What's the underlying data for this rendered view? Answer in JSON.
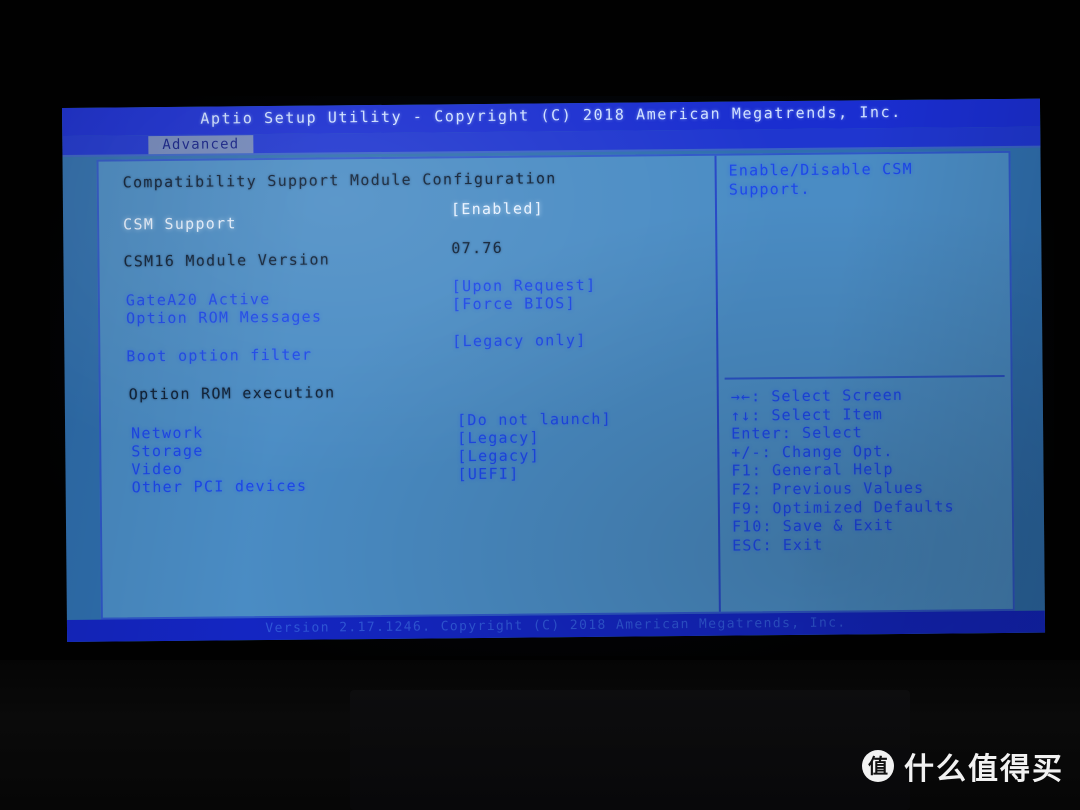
{
  "bios": {
    "title": "Aptio Setup Utility - Copyright (C) 2018 American Megatrends, Inc.",
    "version_bar": "Version 2.17.1246. Copyright (C) 2018 American Megatrends, Inc.",
    "tabs": [
      {
        "label": "Advanced",
        "selected": true
      }
    ],
    "page_heading": "Compatibility Support Module Configuration",
    "rows": [
      {
        "label": "CSM Support",
        "value": "[Enabled]",
        "kind": "selected"
      },
      {
        "label": "CSM16 Module Version",
        "value": "07.76",
        "kind": "static"
      },
      {
        "label": "GateA20 Active",
        "value": "[Upon Request]",
        "kind": "item"
      },
      {
        "label": "Option ROM Messages",
        "value": "[Force BIOS]",
        "kind": "item"
      },
      {
        "label": "Boot option filter",
        "value": "[Legacy only]",
        "kind": "item"
      },
      {
        "label": "Option ROM execution",
        "value": "",
        "kind": "heading"
      },
      {
        "label": "Network",
        "value": "[Do not launch]",
        "kind": "item"
      },
      {
        "label": "Storage",
        "value": "[Legacy]",
        "kind": "item"
      },
      {
        "label": "Video",
        "value": "[Legacy]",
        "kind": "item"
      },
      {
        "label": "Other PCI devices",
        "value": "[UEFI]",
        "kind": "item"
      }
    ],
    "help_text": "Enable/Disable CSM Support.",
    "key_legend": [
      "→←: Select Screen",
      "↑↓: Select Item",
      "Enter: Select",
      "+/-: Change Opt.",
      "F1: General Help",
      "F2: Previous Values",
      "F9: Optimized Defaults",
      "F10: Save & Exit",
      "ESC: Exit"
    ]
  },
  "watermark": {
    "logo_glyph": "值",
    "text": "什么值得买"
  },
  "colors": {
    "screen_bg": "#4a8cc4",
    "titlebar": "#1a2ed0",
    "tab_bg": "#7388bb",
    "item_text": "#1d47e8",
    "static_text": "#0d1e33",
    "selected_text": "#e8f2ff",
    "frame_border": "#2f57c8"
  }
}
